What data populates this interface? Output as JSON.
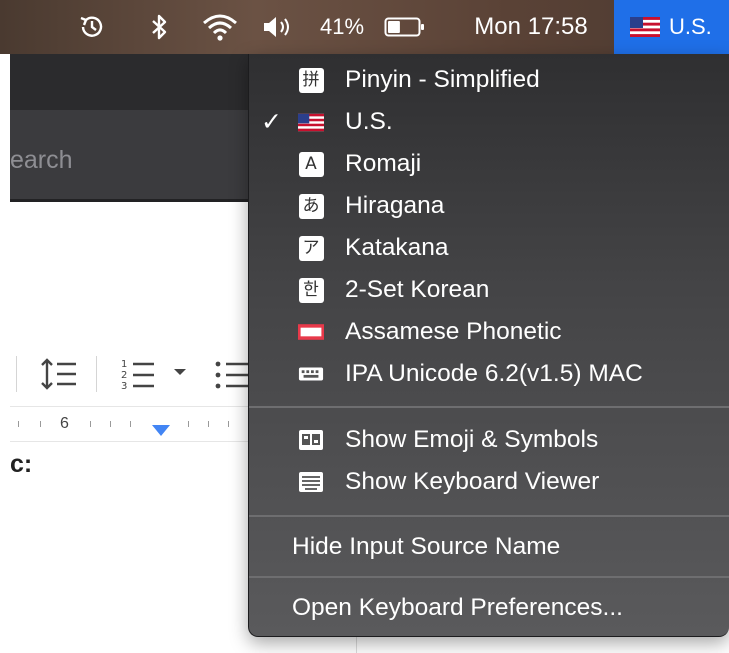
{
  "menubar": {
    "battery_percent": "41%",
    "clock": "Mon 17:58",
    "input_source": "U.S.",
    "battery_level": 0.41,
    "icons": [
      "time-machine-icon",
      "bluetooth-icon",
      "wifi-icon",
      "volume-icon",
      "battery-icon",
      "us-flag-icon"
    ]
  },
  "background_app": {
    "search_text": "earch",
    "ruler_number": "6",
    "doc_text": "c:"
  },
  "menu": {
    "input_sources": [
      {
        "label": "Pinyin - Simplified",
        "icon": "pinyin-icon",
        "glyph": "拼",
        "checked": false
      },
      {
        "label": "U.S.",
        "icon": "us-flag-icon",
        "glyph": "",
        "checked": true
      },
      {
        "label": "Romaji",
        "icon": "romaji-icon",
        "glyph": "A",
        "checked": false
      },
      {
        "label": "Hiragana",
        "icon": "hiragana-icon",
        "glyph": "あ",
        "checked": false
      },
      {
        "label": "Katakana",
        "icon": "katakana-icon",
        "glyph": "ア",
        "checked": false
      },
      {
        "label": "2-Set Korean",
        "icon": "korean-icon",
        "glyph": "한",
        "checked": false
      },
      {
        "label": "Assamese Phonetic",
        "icon": "assamese-flag-icon",
        "glyph": "",
        "checked": false
      },
      {
        "label": "IPA Unicode 6.2(v1.5) MAC",
        "icon": "keyboard-icon",
        "glyph": "",
        "checked": false
      }
    ],
    "check_mark": "✓",
    "show_emoji": "Show Emoji & Symbols",
    "show_keyboard_viewer": "Show Keyboard Viewer",
    "hide_input_source_name": "Hide Input Source Name",
    "open_keyboard_preferences": "Open Keyboard Preferences..."
  },
  "colors": {
    "accent": "#1f6fe8",
    "menu_bg": "#3c3c3e",
    "menubar_bg": "#5a4236",
    "ruler_marker": "#4285f4"
  }
}
